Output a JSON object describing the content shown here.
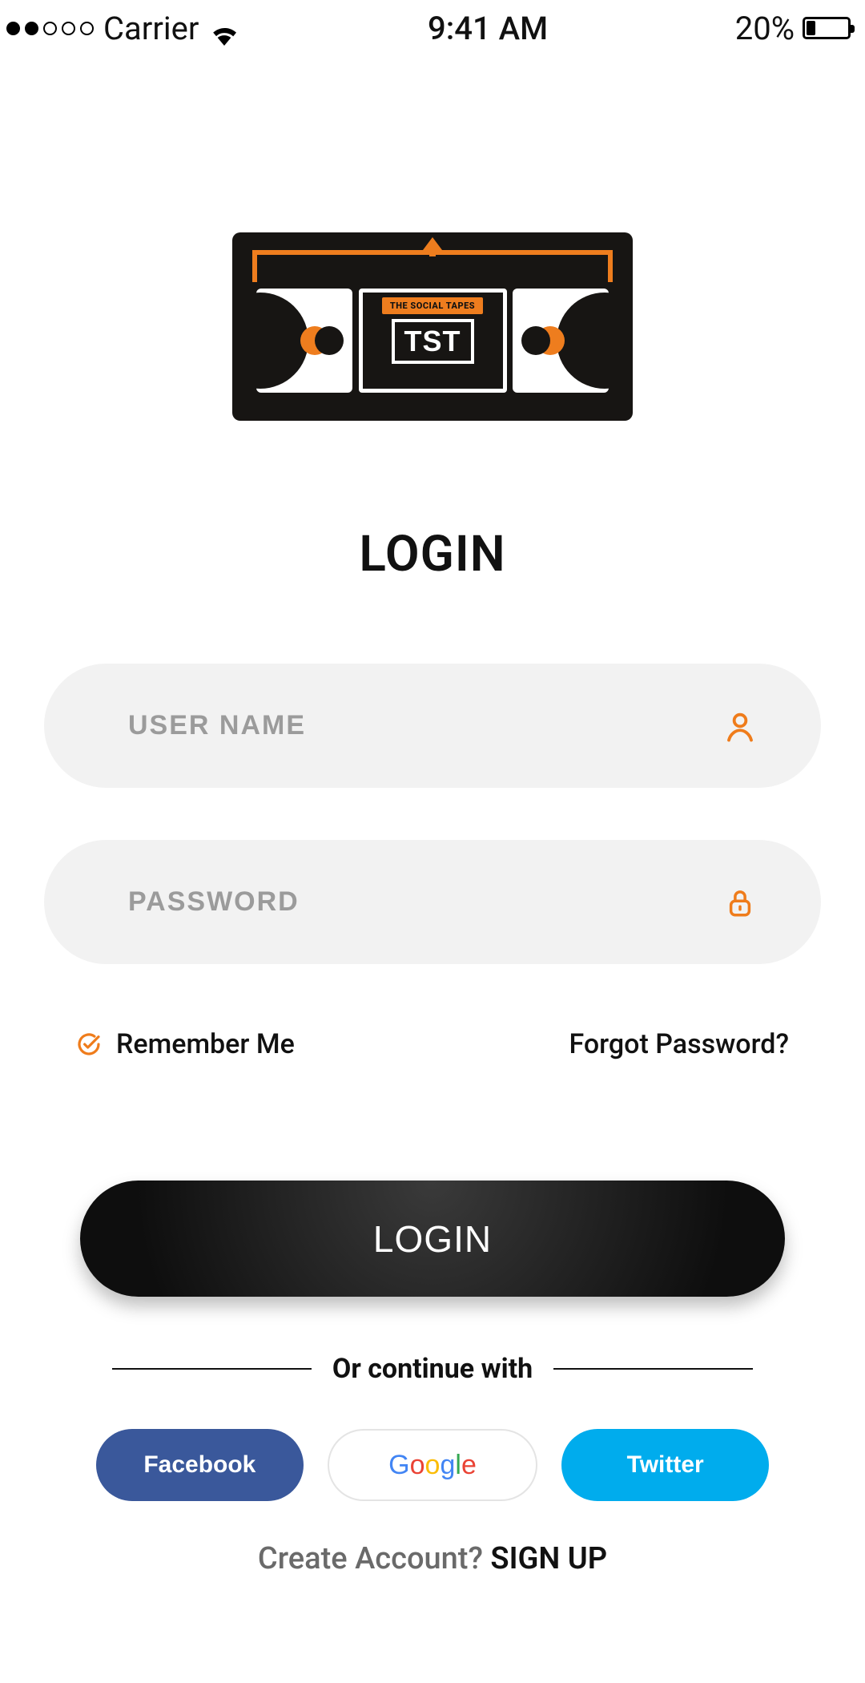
{
  "status": {
    "carrier": "Carrier",
    "time": "9:41 AM",
    "battery_pct": "20%"
  },
  "logo": {
    "banner": "THE SOCIAL TAPES",
    "abbrev": "TST"
  },
  "heading": "LOGIN",
  "form": {
    "username_placeholder": "USER NAME",
    "password_placeholder": "PASSWORD"
  },
  "options": {
    "remember": "Remember Me",
    "forgot": "Forgot Password?"
  },
  "login_button": "LOGIN",
  "divider": "Or continue with",
  "social": {
    "facebook": "Facebook",
    "google": "Google",
    "twitter": "Twitter"
  },
  "signup": {
    "prompt": "Create Account? ",
    "action": "SIGN UP"
  }
}
